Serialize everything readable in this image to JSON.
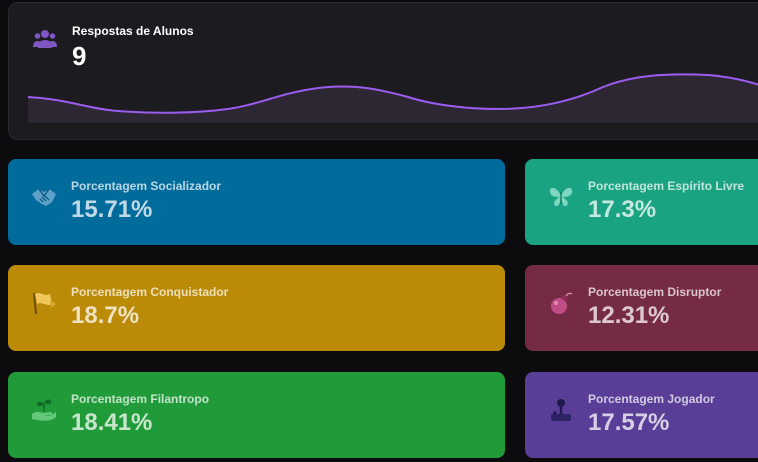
{
  "responses": {
    "label": "Respostas de Alunos",
    "value": "9",
    "icon": "users-icon",
    "sparkline_color": "#9b5cf0"
  },
  "cards": [
    {
      "label": "Porcentagem Socializador",
      "value": "15.71%",
      "icon": "handshake-icon",
      "color": "#016b9b"
    },
    {
      "label": "Porcentagem Espírito Livre",
      "value": "17.3%",
      "icon": "butterfly-icon",
      "color": "#1aa383"
    },
    {
      "label": "Porcentagem Conquistador",
      "value": "18.7%",
      "icon": "flag-icon",
      "color": "#bb8b08"
    },
    {
      "label": "Porcentagem Disruptor",
      "value": "12.31%",
      "icon": "bomb-icon",
      "color": "#762b45"
    },
    {
      "label": "Porcentagem Filantropo",
      "value": "18.41%",
      "icon": "hand-holding-seedling-icon",
      "color": "#219b3a"
    },
    {
      "label": "Porcentagem Jogador",
      "value": "17.57%",
      "icon": "joystick-icon",
      "color": "#593d96"
    }
  ]
}
